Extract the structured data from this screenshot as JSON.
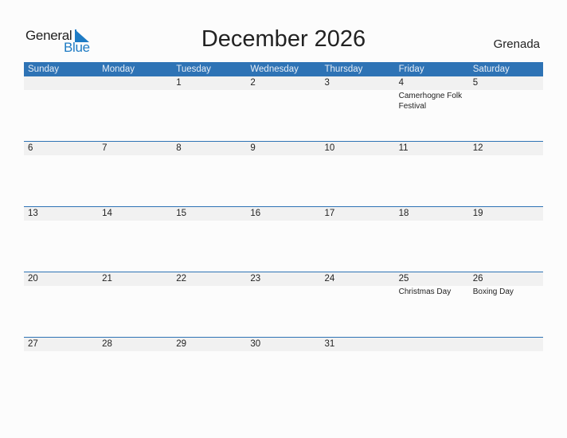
{
  "logo": {
    "general": "General",
    "blue": "Blue",
    "icon": "triangle-flag-icon"
  },
  "title": "December 2026",
  "country": "Grenada",
  "weekdays": [
    "Sunday",
    "Monday",
    "Tuesday",
    "Wednesday",
    "Thursday",
    "Friday",
    "Saturday"
  ],
  "weeks": [
    {
      "days": [
        "",
        "",
        "1",
        "2",
        "3",
        "4",
        "5"
      ],
      "events": [
        "",
        "",
        "",
        "",
        "",
        "Camerhogne Folk Festival",
        ""
      ]
    },
    {
      "days": [
        "6",
        "7",
        "8",
        "9",
        "10",
        "11",
        "12"
      ],
      "events": [
        "",
        "",
        "",
        "",
        "",
        "",
        ""
      ]
    },
    {
      "days": [
        "13",
        "14",
        "15",
        "16",
        "17",
        "18",
        "19"
      ],
      "events": [
        "",
        "",
        "",
        "",
        "",
        "",
        ""
      ]
    },
    {
      "days": [
        "20",
        "21",
        "22",
        "23",
        "24",
        "25",
        "26"
      ],
      "events": [
        "",
        "",
        "",
        "",
        "",
        "Christmas Day",
        "Boxing Day"
      ]
    },
    {
      "days": [
        "27",
        "28",
        "29",
        "30",
        "31",
        "",
        ""
      ],
      "events": [
        "",
        "",
        "",
        "",
        "",
        "",
        ""
      ]
    }
  ],
  "colors": {
    "accent": "#2e73b5",
    "logo_blue": "#1e7bc4",
    "day_bar": "#f1f1f1"
  }
}
